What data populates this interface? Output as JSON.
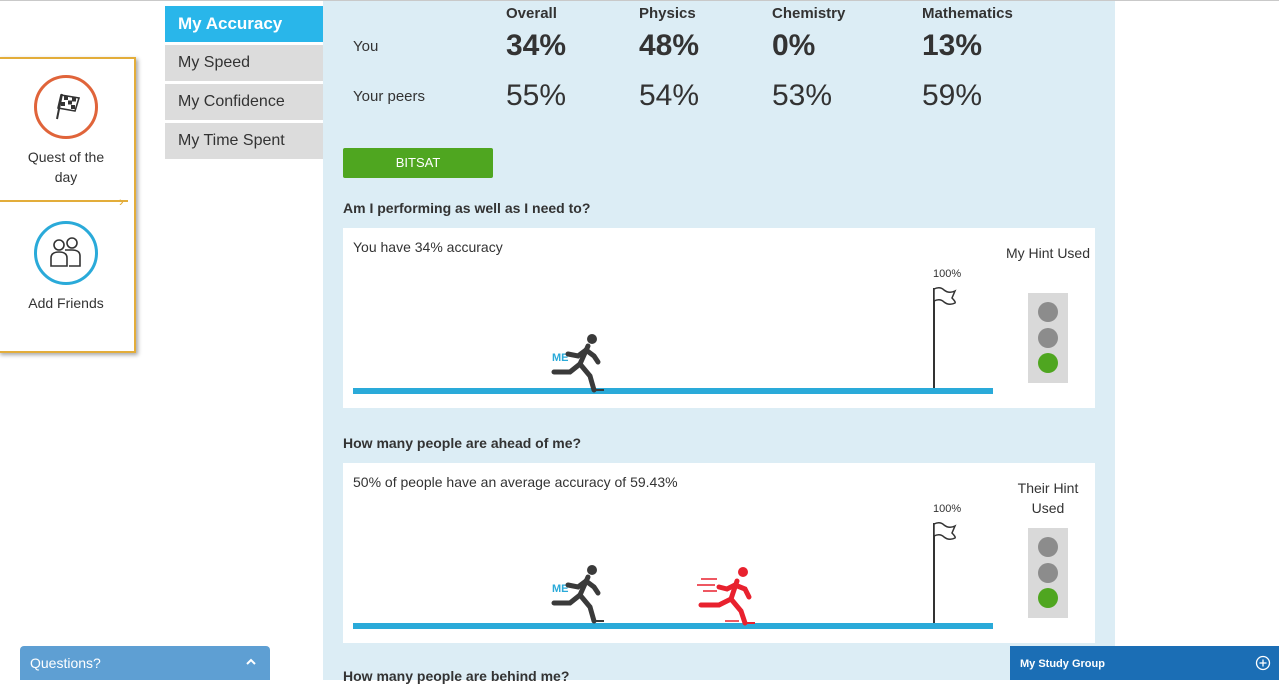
{
  "left_widget": {
    "quest_label": "Quest of the day",
    "add_friends_label": "Add Friends"
  },
  "tabs": [
    {
      "label": "My Accuracy",
      "active": true
    },
    {
      "label": "My Speed",
      "active": false
    },
    {
      "label": "My Confidence",
      "active": false
    },
    {
      "label": "My Time Spent",
      "active": false
    }
  ],
  "stats": {
    "columns": [
      "Overall",
      "Physics",
      "Chemistry",
      "Mathematics"
    ],
    "you_label": "You",
    "peers_label": "Your peers",
    "you_values": [
      "34%",
      "48%",
      "0%",
      "13%"
    ],
    "peer_values": [
      "55%",
      "54%",
      "53%",
      "59%"
    ]
  },
  "exam_button": "BITSAT",
  "section1": {
    "question": "Am I performing as well as I need to?",
    "text": "You have 34% accuracy",
    "flag_label": "100%",
    "me_label": "ME",
    "hint_title": "My Hint Used",
    "lights": [
      "off",
      "off",
      "on"
    ]
  },
  "section2": {
    "question": "How many people are ahead of me?",
    "text": "50% of people have an average accuracy of 59.43%",
    "flag_label": "100%",
    "me_label": "ME",
    "hint_title": "Their Hint Used",
    "lights": [
      "off",
      "off",
      "on"
    ]
  },
  "section3": {
    "question": "How many people are behind me?"
  },
  "questions_bar": {
    "label": "Questions?"
  },
  "study_group": {
    "label": "My Study Group"
  },
  "colors": {
    "accent_blue": "#29b6ea",
    "green": "#4fa620",
    "panel_bg": "#dcedf5",
    "runner_peer": "#e8212e",
    "runner_me": "#3a3a3a"
  }
}
